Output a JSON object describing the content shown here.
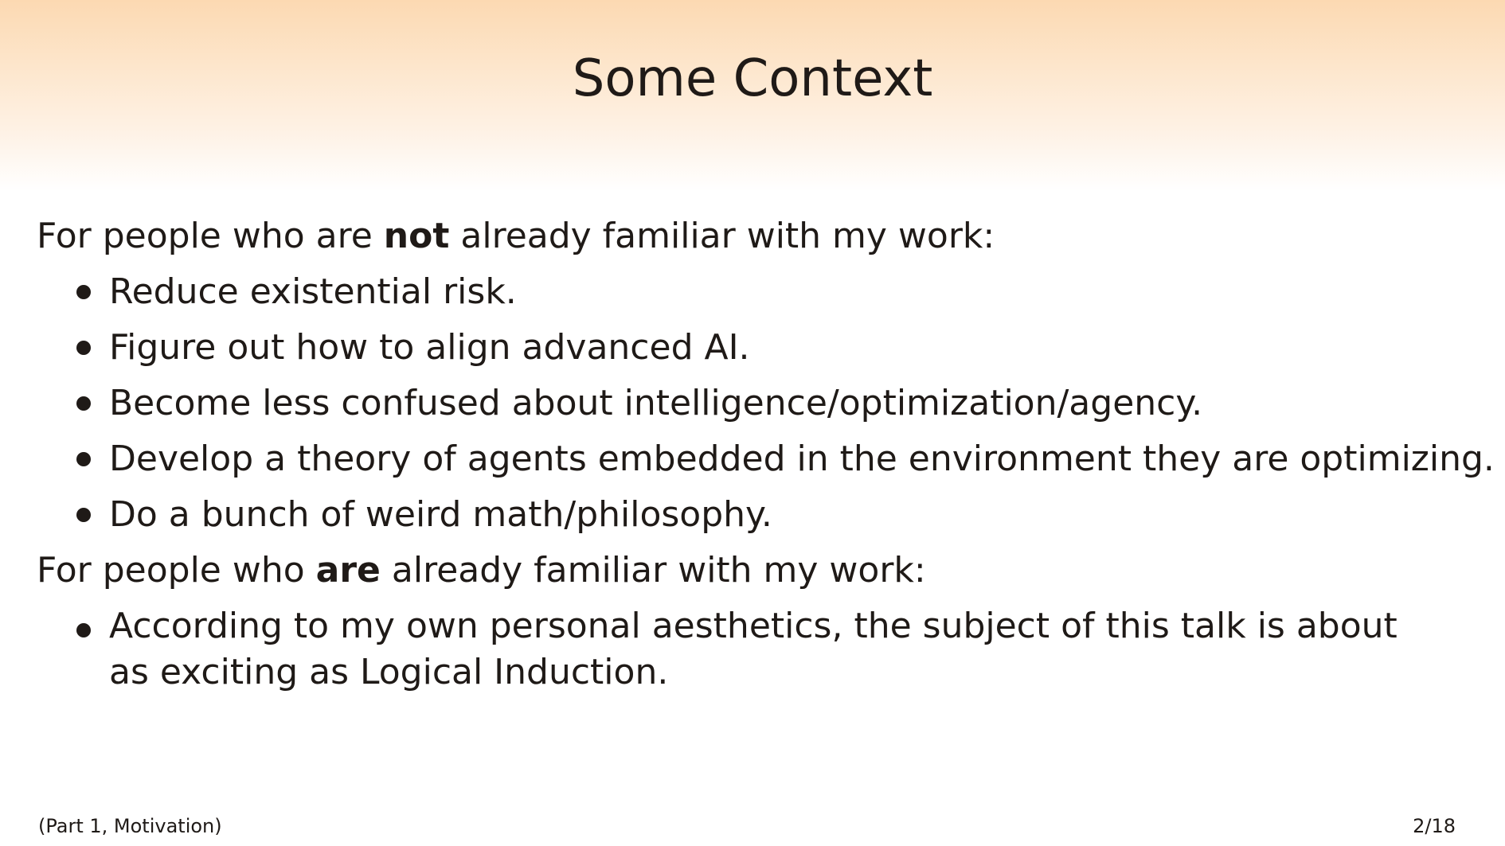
{
  "slide": {
    "title": "Some Context",
    "section1": {
      "prefix": "For people who are ",
      "emphasis": "not",
      "suffix": " already familiar with my work:",
      "items": [
        "Reduce existential risk.",
        "Figure out how to align advanced AI.",
        "Become less confused about intelligence/optimization/agency.",
        "Develop a theory of agents embedded in the environment they are optimizing.",
        "Do a bunch of weird math/philosophy."
      ]
    },
    "section2": {
      "prefix": "For people who ",
      "emphasis": "are",
      "suffix": " already familiar with my work:",
      "items": [
        "According to my own personal aesthetics, the subject of this talk is about as exciting as Logical Induction."
      ]
    },
    "footer": {
      "section_label": "(Part 1, Motivation)",
      "page_number": "2/18"
    }
  }
}
